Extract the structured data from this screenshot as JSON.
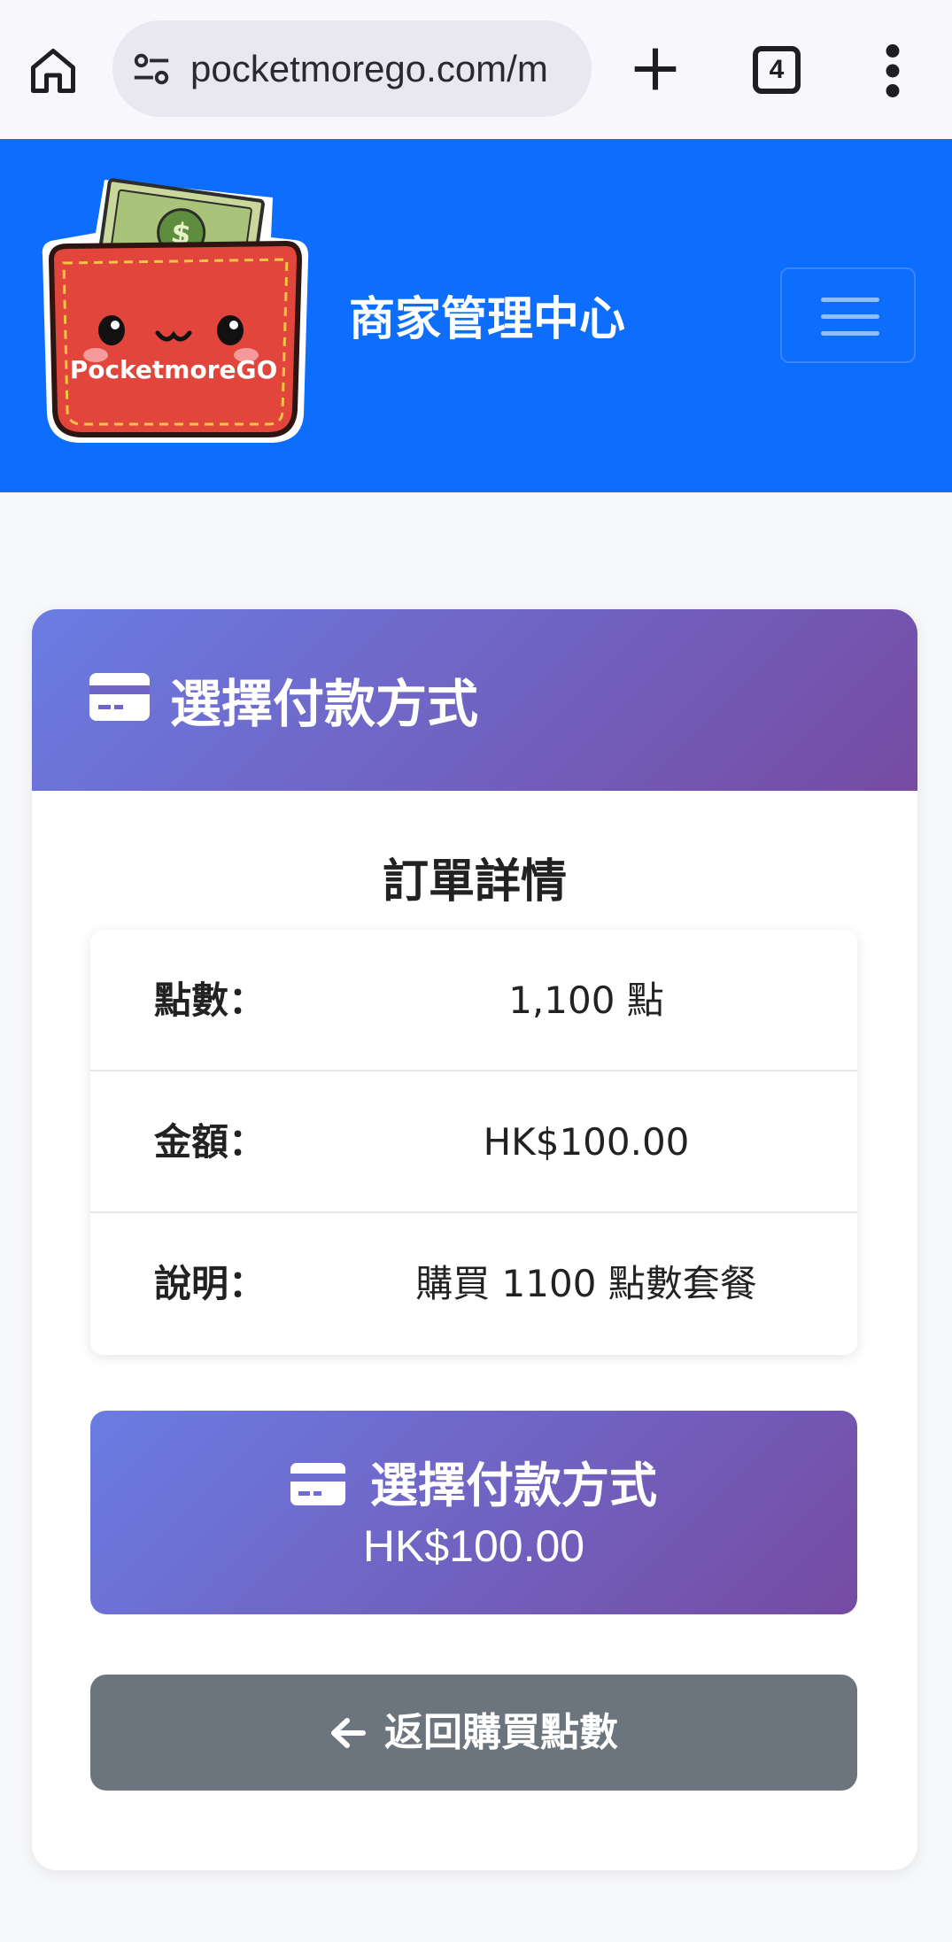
{
  "browser": {
    "url": "pocketmorego.com/m",
    "tab_count": "4",
    "icons": [
      "home-icon",
      "site-settings-icon",
      "new-tab-icon",
      "tab-switcher-icon",
      "more-vert-icon"
    ]
  },
  "header": {
    "logo_text": "PocketmoreGO",
    "title": "商家管理中心"
  },
  "colors": {
    "header_bg": "#0d6efd",
    "gradient_start": "#6a7ce3",
    "gradient_end": "#764ba2",
    "secondary_button": "#6c757d"
  },
  "card": {
    "header_title": "選擇付款方式",
    "section_title": "訂單詳情",
    "details": [
      {
        "label": "點數：",
        "value": "1,100 點"
      },
      {
        "label": "金額：",
        "value": "HK$100.00"
      },
      {
        "label": "說明：",
        "value": "購買 1100 點數套餐"
      }
    ],
    "pay_button": {
      "label": "選擇付款方式",
      "amount": "HK$100.00"
    },
    "back_button": {
      "label": "返回購買點數"
    }
  }
}
